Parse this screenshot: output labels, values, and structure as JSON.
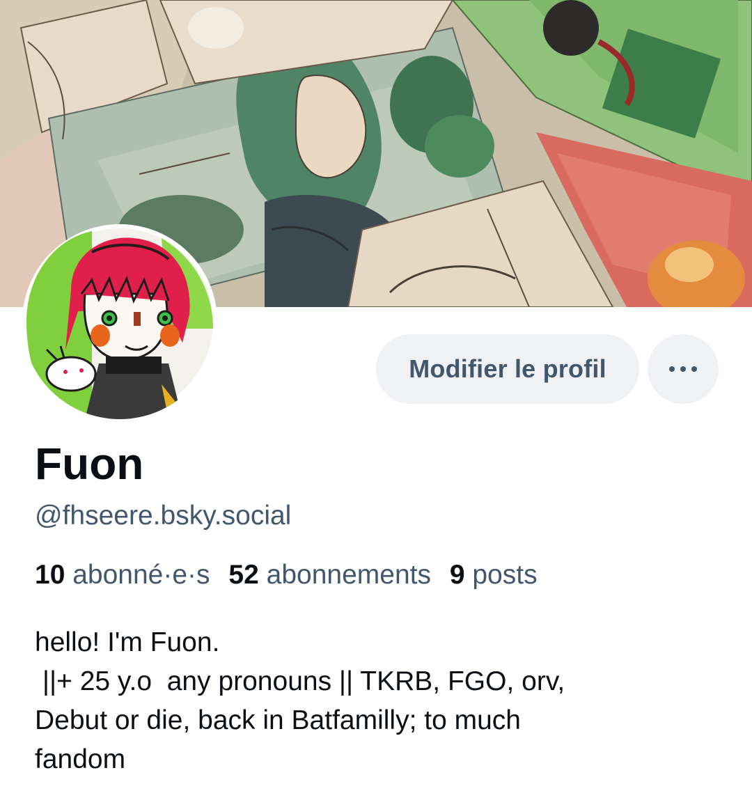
{
  "profile": {
    "display_name": "Fuon",
    "handle": "@fhseere.bsky.social",
    "banner_image": "watercolor-manga-illustrations-banner",
    "avatar_image": "red-haired-character-drawing-avatar"
  },
  "actions": {
    "edit_label": "Modifier le profil",
    "more_icon": "ellipsis-icon"
  },
  "stats": {
    "followers_count": "10",
    "followers_label": "abonné·e·s",
    "following_count": "52",
    "following_label": "abonnements",
    "posts_count": "9",
    "posts_label": "posts"
  },
  "bio": {
    "lines": [
      "hello! I'm Fuon.",
      " ||+ 25 y.o  any pronouns || TKRB, FGO, orv,",
      "Debut or die, back in Batfamilly; to much",
      "fandom"
    ]
  },
  "colors": {
    "text_primary": "#0b0f14",
    "text_secondary": "#42576c",
    "button_bg": "#eff1f4",
    "background": "#ffffff"
  }
}
